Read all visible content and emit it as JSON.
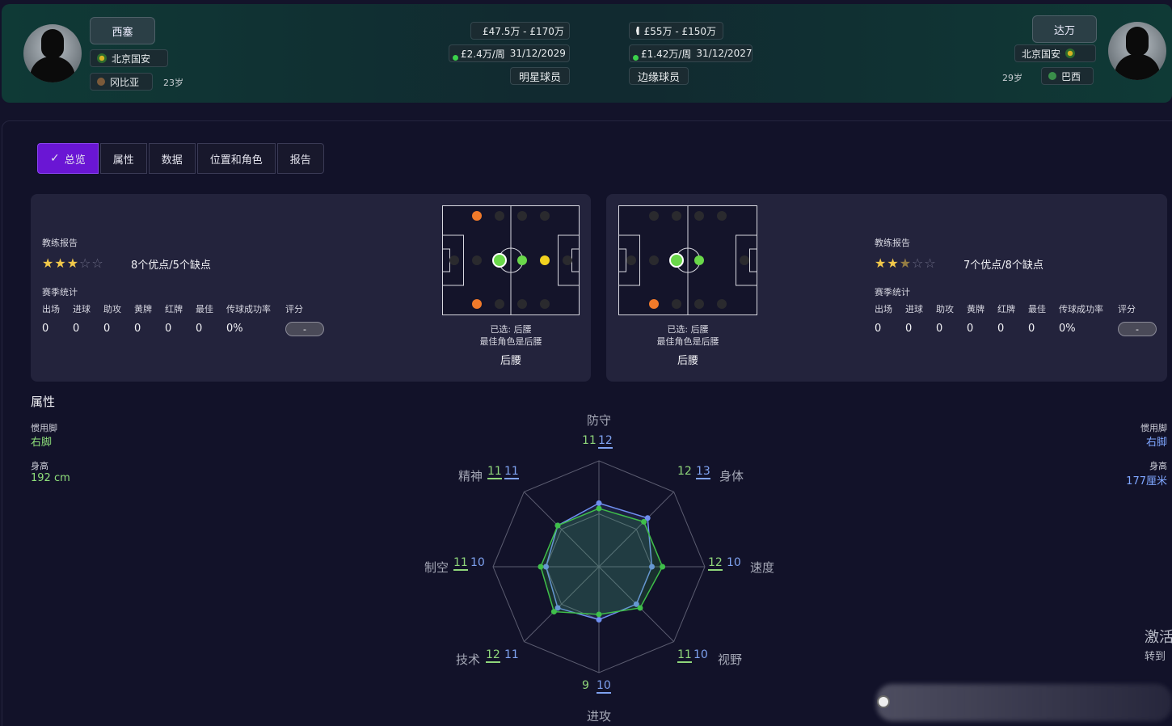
{
  "left_player": {
    "name": "西塞",
    "club": "北京国安",
    "nationality": "冈比亚",
    "age": "23岁",
    "value": "£47.5万 - £170万",
    "wage": "£2.4万/周",
    "contract_end": "31/12/2029",
    "status": "明星球员",
    "preferred_foot_label": "惯用脚",
    "preferred_foot": "右脚",
    "height_label": "身高",
    "height": "192 cm"
  },
  "right_player": {
    "name": "达万",
    "club": "北京国安",
    "nationality": "巴西",
    "age": "29岁",
    "value": "£55万 - £150万",
    "wage": "£1.42万/周",
    "contract_end": "31/12/2027",
    "status": "边缘球员",
    "preferred_foot_label": "惯用脚",
    "preferred_foot": "右脚",
    "height_label": "身高",
    "height": "177厘米"
  },
  "tabs": [
    {
      "label": "总览",
      "active": true
    },
    {
      "label": "属性",
      "active": false
    },
    {
      "label": "数据",
      "active": false
    },
    {
      "label": "位置和角色",
      "active": false
    },
    {
      "label": "报告",
      "active": false
    }
  ],
  "left_card": {
    "coach_report_label": "教练报告",
    "stars": 3,
    "max_stars": 5,
    "pros_cons": "8个优点/5个缺点",
    "season_stats_label": "赛季统计",
    "stat_headers": [
      "出场",
      "进球",
      "助攻",
      "黄牌",
      "红牌",
      "最佳",
      "传球成功率",
      "评分"
    ],
    "stat_values": [
      "0",
      "0",
      "0",
      "0",
      "0",
      "0",
      "0%",
      "-"
    ],
    "selected_line": "已选: 后腰",
    "best_role_line": "最佳角色是后腰",
    "role": "后腰"
  },
  "right_card": {
    "coach_report_label": "教练报告",
    "stars": 2.5,
    "max_stars": 5,
    "pros_cons": "7个优点/8个缺点",
    "season_stats_label": "赛季统计",
    "stat_headers": [
      "出场",
      "进球",
      "助攻",
      "黄牌",
      "红牌",
      "最佳",
      "传球成功率",
      "评分"
    ],
    "stat_values": [
      "0",
      "0",
      "0",
      "0",
      "0",
      "0",
      "0%",
      "-"
    ],
    "selected_line": "已选: 后腰",
    "best_role_line": "最佳角色是后腰",
    "role": "后腰"
  },
  "attributes_title": "属性",
  "radar": {
    "axes": [
      {
        "label": "防守",
        "left": "11",
        "right": "12"
      },
      {
        "label": "身体",
        "left": "12",
        "right": "13"
      },
      {
        "label": "速度",
        "left": "12",
        "right": "10"
      },
      {
        "label": "视野",
        "left": "11",
        "right": "10"
      },
      {
        "label": "进攻",
        "left": "9",
        "right": "10"
      },
      {
        "label": "技术",
        "left": "12",
        "right": "11"
      },
      {
        "label": "制空",
        "left": "11",
        "right": "10"
      },
      {
        "label": "精神",
        "left": "11",
        "right": "11"
      }
    ],
    "max": 20
  },
  "activation": {
    "title": "激活",
    "subtitle": "转到"
  },
  "colors": {
    "left_series": "#3fbf4a",
    "right_series": "#6f8ff0",
    "accent": "#6a16d4"
  }
}
